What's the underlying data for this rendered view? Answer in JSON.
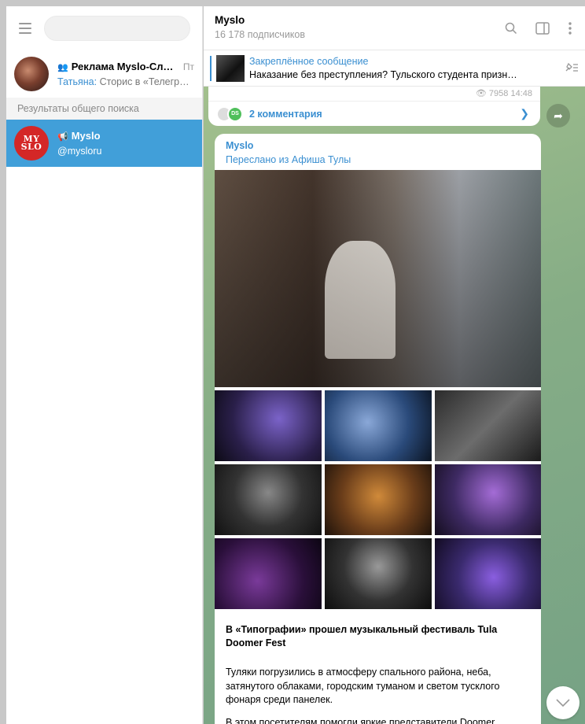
{
  "sidebar": {
    "search": {
      "value": "",
      "placeholder": ""
    },
    "dialogs": [
      {
        "name": "Реклама Myslo-Сло…",
        "date": "Пт",
        "sender": "Татьяна:",
        "preview": "Сторис в «Телегра…",
        "kind": "group"
      }
    ],
    "global_search_label": "Результаты общего поиска",
    "global_results": [
      {
        "name": "Myslo",
        "username": "@mysloru",
        "kind": "channel",
        "avatar_text": [
          "MY",
          "SLO"
        ]
      }
    ]
  },
  "chat": {
    "title": "Myslo",
    "subscribers": "16 178 подписчиков",
    "pinned": {
      "title": "Закреплённое сообщение",
      "text": "Наказание без преступления? Тульского студента призн…"
    },
    "previous_message": {
      "views": "7958",
      "time": "14:48",
      "comments_label": "2 комментария",
      "commenter_initials": "DS"
    },
    "post": {
      "author": "Myslo",
      "forwarded": "Переслано из Афиша Тулы",
      "headline": "В «Типографии» прошел музыкальный фестиваль Tula Doomer Fest",
      "paragraph1": "Туляки погрузились в атмосферу спального района, неба, затянутого облаками, городским туманом и светом тусклого фонаря среди панелек.",
      "paragraph2": "В этом посетителям помогли яркие представители Doomer"
    }
  },
  "colors": {
    "accent": "#3a8fd1",
    "active_dialog": "#419fd9",
    "avatar_red": "#d42727"
  }
}
